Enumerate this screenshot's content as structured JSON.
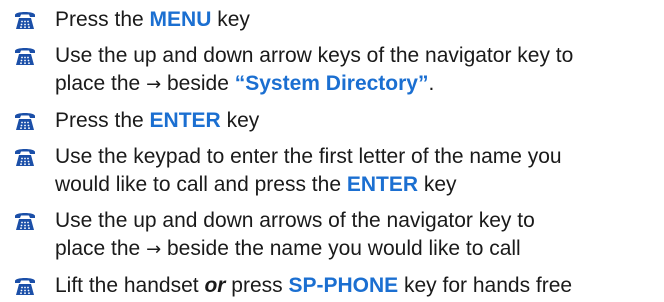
{
  "icon": {
    "name": "telephone-icon",
    "color": "#1b4fa8"
  },
  "steps": [
    {
      "pre": "Press the ",
      "key": "MENU",
      "post": " key"
    },
    {
      "line1": "Use the up and down arrow keys of the navigator key to",
      "line2_pre": "place the ",
      "arrow": "→",
      "line2_mid": " beside ",
      "key": "“System Directory”",
      "line2_post": "."
    },
    {
      "pre": "Press the ",
      "key": "ENTER",
      "post": " key"
    },
    {
      "line1": "Use the keypad to enter the first letter of the name you",
      "line2_pre": "would like to call and press the ",
      "key": "ENTER",
      "line2_post": " key"
    },
    {
      "line1": "Use the up and down arrows of the navigator key to",
      "line2_pre": "place the ",
      "arrow": "→",
      "line2_post": " beside the name you would like to call"
    },
    {
      "pre": "Lift the handset ",
      "em": "or",
      "mid": " press ",
      "key": "SP-PHONE",
      "post": " key for hands free"
    }
  ]
}
